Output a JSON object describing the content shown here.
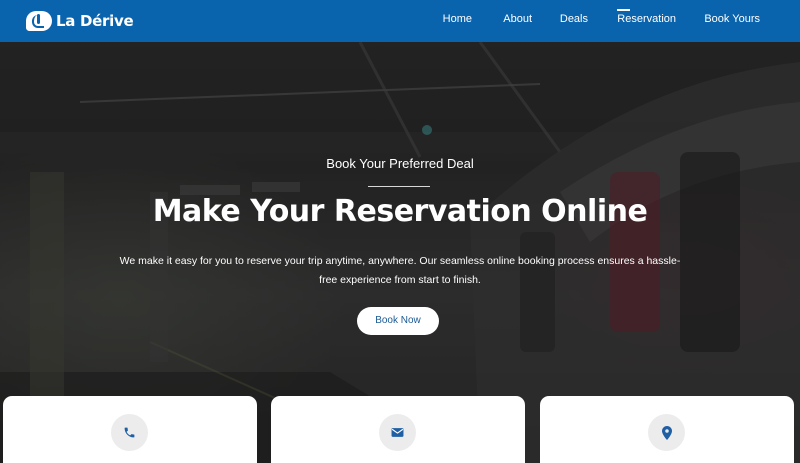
{
  "brand": {
    "name": "La Dérive",
    "logo_icon": "wave-logo-icon"
  },
  "nav": {
    "items": [
      {
        "label": "Home",
        "active": false
      },
      {
        "label": "About",
        "active": false
      },
      {
        "label": "Deals",
        "active": false
      },
      {
        "label": "Reservation",
        "active": true
      },
      {
        "label": "Book Yours",
        "active": false
      }
    ]
  },
  "hero": {
    "subtitle": "Book Your Preferred Deal",
    "title": "Make Your Reservation Online",
    "description": "We make it easy for you to reserve your trip anytime, anywhere. Our seamless online booking process ensures a hassle-free experience from start to finish.",
    "button_label": "Book Now"
  },
  "cards": [
    {
      "icon": "phone-icon"
    },
    {
      "icon": "envelope-icon"
    },
    {
      "icon": "map-pin-icon"
    }
  ],
  "colors": {
    "brand_blue": "#0a63ad",
    "button_text": "#1b5a95",
    "icon_blue": "#1f5fa3"
  }
}
